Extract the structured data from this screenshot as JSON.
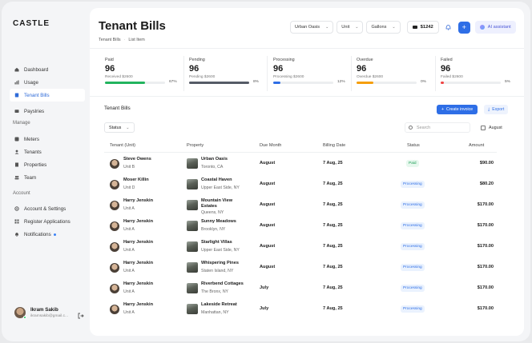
{
  "app": {
    "logo": "CASTLE"
  },
  "sidebar": {
    "items": [
      {
        "label": "Dashboard",
        "icon": "home-icon"
      },
      {
        "label": "Usage",
        "icon": "chart-icon"
      },
      {
        "label": "Tenant Bills",
        "icon": "bill-icon",
        "active": true
      },
      {
        "label": "Payslries",
        "icon": "wallet-icon"
      }
    ],
    "manage_label": "Manage",
    "manage_items": [
      {
        "label": "Meters",
        "icon": "meter-icon"
      },
      {
        "label": "Tenants",
        "icon": "users-icon"
      },
      {
        "label": "Properties",
        "icon": "building-icon"
      },
      {
        "label": "Team",
        "icon": "team-icon"
      }
    ],
    "account_label": "Account",
    "account_items": [
      {
        "label": "Account & Settings",
        "icon": "gear-icon"
      },
      {
        "label": "Register Applications",
        "icon": "apps-icon"
      },
      {
        "label": "Notifications",
        "icon": "bell-icon"
      }
    ],
    "user": {
      "name": "Ikram Sakib",
      "email": "ikramsakib@gmail.c..."
    }
  },
  "header": {
    "title": "Tenant Bills",
    "breadcrumb": [
      "Tenant Bills",
      "List Item"
    ],
    "filters": [
      "Urban Oasis",
      "Unit",
      "Gallons"
    ],
    "credit": "$1242",
    "ai_label": "AI assistant"
  },
  "stats": [
    {
      "label": "Paid",
      "value": "96",
      "sub": "Received $2600",
      "pct_label": "67%",
      "fill": 0.67,
      "color": "#22b45e"
    },
    {
      "label": "Pending",
      "value": "96",
      "sub": "Pending $2600",
      "pct_label": "8%",
      "fill": 1.0,
      "color": "#555b66"
    },
    {
      "label": "Processing",
      "value": "96",
      "sub": "Processing $2600",
      "pct_label": "12%",
      "fill": 0.12,
      "color": "#2e6ee6"
    },
    {
      "label": "Overdue",
      "value": "96",
      "sub": "Overdue    $2600",
      "pct_label": "0%",
      "fill": 0.28,
      "color": "#f59e0b"
    },
    {
      "label": "Failed",
      "value": "96",
      "sub": "Failed $2600",
      "pct_label": "5%",
      "fill": 0.05,
      "color": "#ef4444"
    }
  ],
  "bills": {
    "title": "Tenant Bills",
    "create_label": "Create invoice",
    "export_label": "Export",
    "status_filter": "Status",
    "search_placeholder": "Search",
    "date_label": "August",
    "columns": [
      "Tenant (Unit)",
      "Property",
      "Due Month",
      "Billing Date",
      "Status",
      "Amount"
    ],
    "rows": [
      {
        "tenant": "Steve Owens",
        "unit": "Unit B",
        "property": "Urban Oasis",
        "address": "Toronto, CA",
        "due": "August",
        "billing": "7 Aug, 25",
        "status": "Paid",
        "status_type": "paid",
        "amount": "$90.00"
      },
      {
        "tenant": "Moser Killin",
        "unit": "Unit D",
        "property": "Coastal Haven",
        "address": "Upper East Side, NY",
        "due": "August",
        "billing": "7 Aug, 25",
        "status": "Processing",
        "status_type": "proc",
        "amount": "$80.20"
      },
      {
        "tenant": "Harry Jenskin",
        "unit": "Unit A",
        "property": "Mountain View Estates",
        "address": "Queens, NY",
        "due": "August",
        "billing": "7 Aug, 25",
        "status": "Processing",
        "status_type": "proc",
        "amount": "$170.00"
      },
      {
        "tenant": "Harry Jenskin",
        "unit": "Unit A",
        "property": "Sunny Meadows",
        "address": "Brooklyn, NY",
        "due": "August",
        "billing": "7 Aug, 25",
        "status": "Processing",
        "status_type": "proc",
        "amount": "$170.00"
      },
      {
        "tenant": "Harry Jenskin",
        "unit": "Unit A",
        "property": "Starlight Villas",
        "address": "Upper East Side, NY",
        "due": "August",
        "billing": "7 Aug, 25",
        "status": "Processing",
        "status_type": "proc",
        "amount": "$170.00"
      },
      {
        "tenant": "Harry Jenskin",
        "unit": "Unit A",
        "property": "Whispering Pines",
        "address": "Staten Island, NY",
        "due": "August",
        "billing": "7 Aug, 25",
        "status": "Processing",
        "status_type": "proc",
        "amount": "$170.00"
      },
      {
        "tenant": "Harry Jenskin",
        "unit": "Unit A",
        "property": "Riverbend Cottages",
        "address": "The Bronx, NY",
        "due": "July",
        "billing": "7 Aug, 25",
        "status": "Processing",
        "status_type": "proc",
        "amount": "$170.00"
      },
      {
        "tenant": "Harry Jenskin",
        "unit": "Unit A",
        "property": "Lakeside Retreat",
        "address": "Manhattan, NY",
        "due": "July",
        "billing": "7 Aug, 25",
        "status": "Processing",
        "status_type": "proc",
        "amount": "$170.00"
      }
    ]
  }
}
